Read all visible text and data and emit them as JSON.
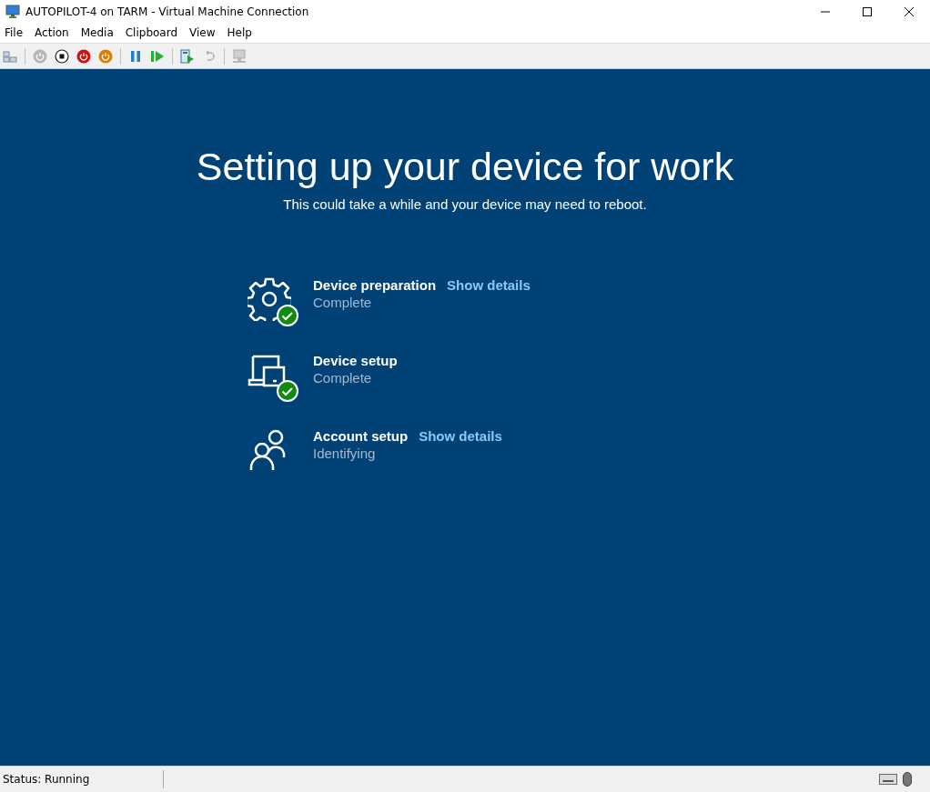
{
  "window": {
    "title": "AUTOPILOT-4 on TARM - Virtual Machine Connection"
  },
  "menu": [
    "File",
    "Action",
    "Media",
    "Clipboard",
    "View",
    "Help"
  ],
  "toolbar": [
    {
      "kind": "ctrlaltdel",
      "disabled": false
    },
    {
      "kind": "separator"
    },
    {
      "kind": "start",
      "disabled": true
    },
    {
      "kind": "stop",
      "disabled": false
    },
    {
      "kind": "poweroff",
      "disabled": false
    },
    {
      "kind": "shutdown",
      "disabled": false
    },
    {
      "kind": "separator"
    },
    {
      "kind": "pause",
      "disabled": false
    },
    {
      "kind": "resume",
      "disabled": false
    },
    {
      "kind": "separator"
    },
    {
      "kind": "checkpoint",
      "disabled": false
    },
    {
      "kind": "revert",
      "disabled": true
    },
    {
      "kind": "separator"
    },
    {
      "kind": "session",
      "disabled": true
    }
  ],
  "screen": {
    "heading": "Setting up your device for work",
    "subtitle": "This could take a while and your device may need to reboot.",
    "steps": [
      {
        "kind": "gear",
        "name": "Device preparation",
        "link": "Show details",
        "status": "Complete",
        "done": true
      },
      {
        "kind": "devices",
        "name": "Device setup",
        "status": "Complete",
        "done": true
      },
      {
        "kind": "people",
        "name": "Account setup",
        "link": "Show details",
        "status": "Identifying",
        "done": false
      }
    ]
  },
  "status_bar": {
    "text": "Status: Running"
  }
}
